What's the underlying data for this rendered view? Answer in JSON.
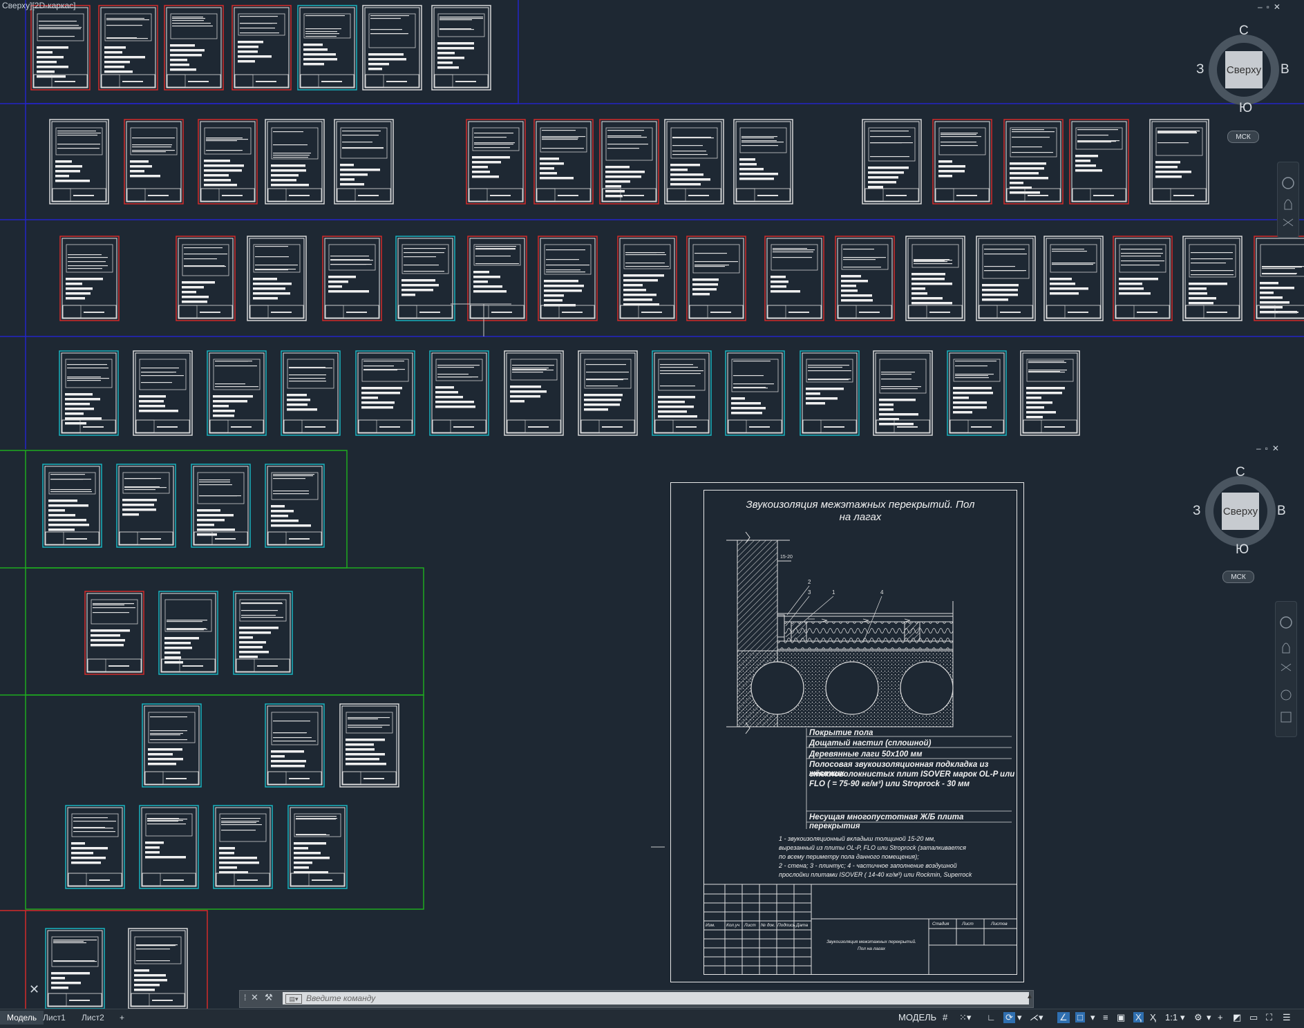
{
  "viewport": {
    "label": "Сверху][2D-каркас]"
  },
  "viewcube_top": {
    "face": "Сверху",
    "north": "С",
    "south": "Ю",
    "west": "З",
    "east": "В",
    "wcs": "МСК"
  },
  "viewcube_bottom": {
    "face": "Сверху",
    "north": "С",
    "south": "Ю",
    "west": "З",
    "east": "В",
    "wcs": "МСК"
  },
  "detail_sheet": {
    "title_line1": "Звукоизоляция межэтажных перекрытий. Пол",
    "title_line2": "на лагах",
    "dim_label": "15-20",
    "callouts": [
      "2",
      "3",
      "1",
      "4"
    ],
    "legend": [
      "Покрытие пола",
      "Дощатый настил (сплошной)",
      "Деревянные лаги 50х100 мм",
      "Полосовая звукоизоляционная подкладка из жёстких",
      "стекловолокнистых плит ISOVER марок OL-P или",
      "FLO (   = 75-90 кг/м³) или Stroprock - 30 мм",
      "Несущая многопустотная Ж/Б плита перекрытия"
    ],
    "notes": [
      "1 - звукоизоляционный вкладыш толщиной 15-20 мм,",
      "вырезанный из плиты OL-P, FLO или Stroprock (заталкивается",
      "по всему периметру пола данного помещения);",
      "2 - стена; 3 - плинтус; 4 - частичное заполнение воздушной",
      "прослойки плитами ISOVER (   14-40 кг/м³) или Rockmin, Superrock"
    ],
    "titleblock": {
      "cols": [
        "Изм.",
        "Кол.уч",
        "Лист",
        "№ док.",
        "Подпись",
        "Дата"
      ],
      "stage_cols": [
        "Стадия",
        "Лист",
        "Листов"
      ],
      "name_line1": "Звукоизоляция межэтажных перекрытий.",
      "name_line2": "Пол на лагах"
    }
  },
  "command_line": {
    "placeholder": "Введите  команду"
  },
  "layout_tabs": [
    "Модель",
    "Лист1",
    "Лист2"
  ],
  "add_tab_label": "+",
  "status_bar": {
    "model_label": "МОДЕЛЬ",
    "scale_label": "1:1"
  }
}
